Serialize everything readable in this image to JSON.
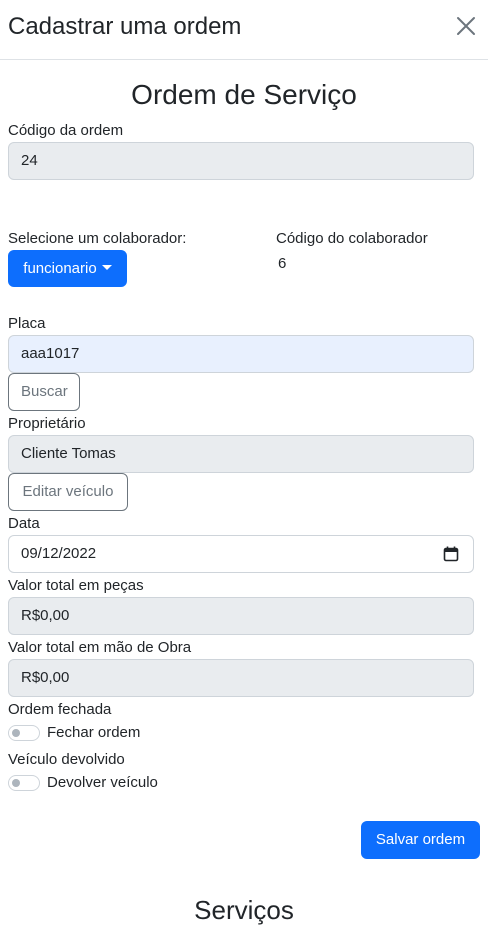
{
  "modal": {
    "title": "Cadastrar uma ordem",
    "close_icon": "close-icon"
  },
  "form": {
    "heading": "Ordem de Serviço",
    "order_code": {
      "label": "Código da ordem",
      "value": "24"
    },
    "collaborator": {
      "select_label": "Selecione um colaborador:",
      "dropdown_value": "funcionario",
      "code_label": "Código do colaborador",
      "code_value": "6"
    },
    "plate": {
      "label": "Placa",
      "value": "aaa1017",
      "search_button": "Buscar"
    },
    "owner": {
      "label": "Proprietário",
      "value": "Cliente Tomas",
      "edit_button": "Editar veículo"
    },
    "date": {
      "label": "Data",
      "value": "09/12/2022",
      "icon": "calendar-icon"
    },
    "parts_total": {
      "label": "Valor total em peças",
      "value": "R$0,00"
    },
    "labor_total": {
      "label": "Valor total em mão de Obra",
      "value": "R$0,00"
    },
    "order_closed": {
      "label": "Ordem fechada",
      "switch_label": "Fechar ordem",
      "checked": false
    },
    "vehicle_returned": {
      "label": "Veículo devolvido",
      "switch_label": "Devolver veículo",
      "checked": false
    },
    "save_button": "Salvar ordem"
  },
  "services": {
    "heading": "Serviços"
  },
  "colors": {
    "primary": "#0d6efd",
    "readonly_bg": "#e9ecef",
    "autofill_bg": "#e8f0fe",
    "outline": "#6c757d"
  }
}
